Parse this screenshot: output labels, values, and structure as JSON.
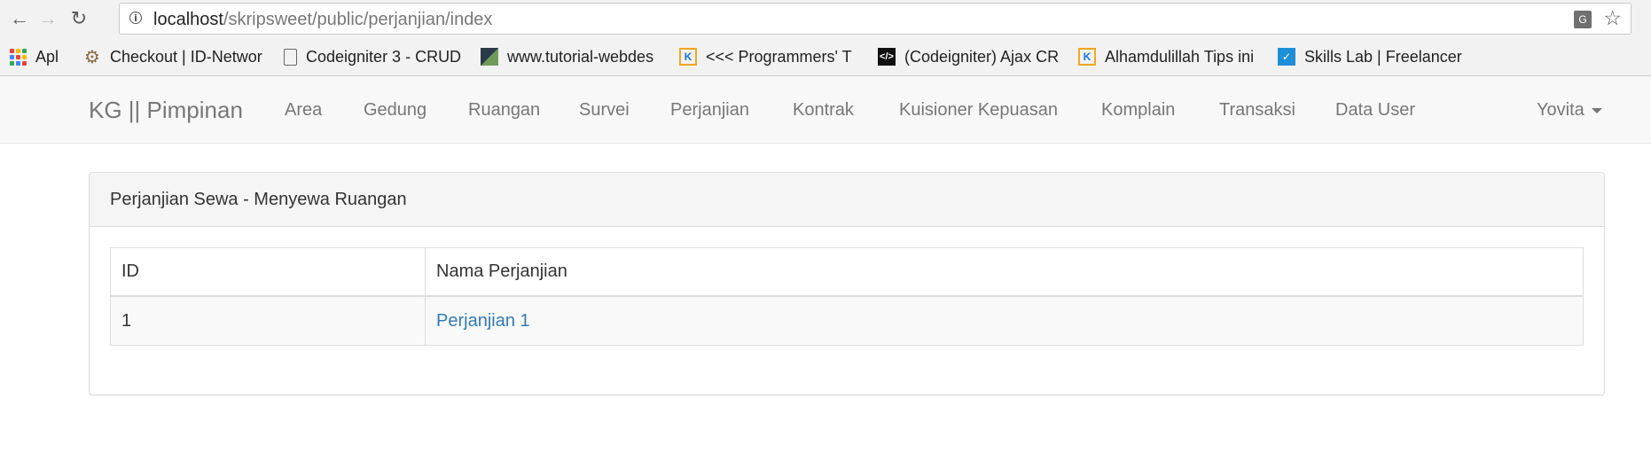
{
  "browser": {
    "url_host": "localhost",
    "url_path": "/skripsweet/public/perjanjian/index",
    "bookmarks": [
      {
        "label": "Apl",
        "icon": "apps-grid-icon"
      },
      {
        "label": "Checkout | ID-Networ",
        "icon": "gear-icon"
      },
      {
        "label": "Codeigniter 3 - CRUD",
        "icon": "document-icon"
      },
      {
        "label": "www.tutorial-webdes",
        "icon": "tutorial-favicon-icon"
      },
      {
        "label": "<<< Programmers' T",
        "icon": "kodingkeun-favicon-icon"
      },
      {
        "label": "(Codeigniter) Ajax CR",
        "icon": "code-favicon-icon"
      },
      {
        "label": "Alhamdulillah Tips ini",
        "icon": "kodingkeun-favicon-icon"
      },
      {
        "label": "Skills Lab | Freelancer",
        "icon": "freelancer-favicon-icon"
      }
    ]
  },
  "navbar": {
    "brand": "KG || Pimpinan",
    "items": [
      {
        "label": "Area"
      },
      {
        "label": "Gedung"
      },
      {
        "label": "Ruangan"
      },
      {
        "label": "Survei"
      },
      {
        "label": "Perjanjian"
      },
      {
        "label": "Kontrak"
      },
      {
        "label": "Kuisioner Kepuasan"
      },
      {
        "label": "Komplain"
      },
      {
        "label": "Transaksi"
      },
      {
        "label": "Data User"
      }
    ],
    "user": "Yovita"
  },
  "panel": {
    "heading": "Perjanjian Sewa - Menyewa Ruangan",
    "table": {
      "headers": [
        "ID",
        "Nama Perjanjian"
      ],
      "rows": [
        {
          "id": "1",
          "name": "Perjanjian 1"
        }
      ]
    }
  },
  "colors": {
    "link": "#337ab7",
    "navbar_bg": "#f8f8f8",
    "panel_heading_bg": "#f5f5f5"
  }
}
